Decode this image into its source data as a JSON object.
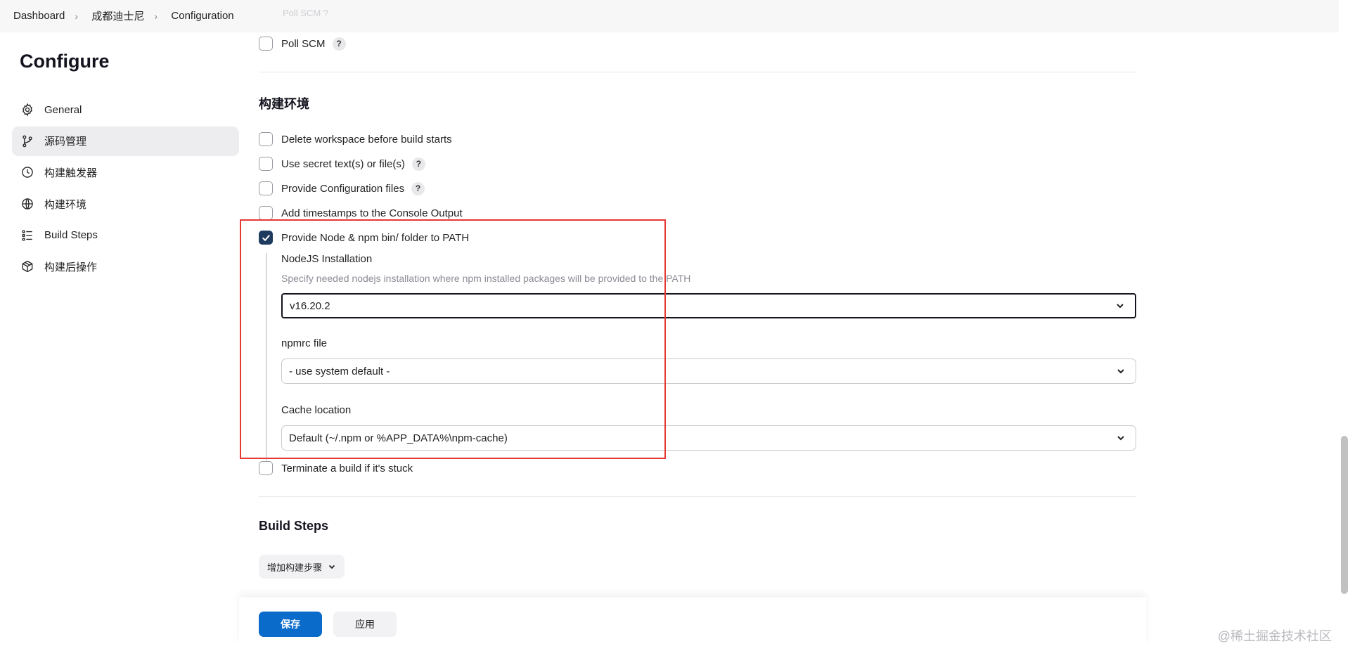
{
  "breadcrumb": {
    "items": [
      "Dashboard",
      "成都迪士尼",
      "Configuration"
    ],
    "hidden_row_text": "Poll SCM ?"
  },
  "page_title": "Configure",
  "sidebar": {
    "items": [
      {
        "label": "General",
        "icon": "gear-icon",
        "active": false
      },
      {
        "label": "源码管理",
        "icon": "source-branch-icon",
        "active": true
      },
      {
        "label": "构建触发器",
        "icon": "clock-icon",
        "active": false
      },
      {
        "label": "构建环境",
        "icon": "globe-icon",
        "active": false
      },
      {
        "label": "Build Steps",
        "icon": "list-icon",
        "active": false
      },
      {
        "label": "构建后操作",
        "icon": "package-icon",
        "active": false
      }
    ]
  },
  "triggers": {
    "poll_scm": {
      "label": "Poll SCM",
      "checked": false,
      "help": "?"
    }
  },
  "build_env": {
    "title": "构建环境",
    "options": [
      {
        "label": "Delete workspace before build starts",
        "checked": false
      },
      {
        "label": "Use secret text(s) or file(s)",
        "checked": false,
        "help": "?"
      },
      {
        "label": "Provide Configuration files",
        "checked": false,
        "help": "?"
      },
      {
        "label": "Add timestamps to the Console Output",
        "checked": false
      },
      {
        "label": "Provide Node & npm bin/ folder to PATH",
        "checked": true
      }
    ],
    "node": {
      "installation_label": "NodeJS Installation",
      "installation_desc": "Specify needed nodejs installation where npm installed packages will be provided to the PATH",
      "installation_value": "v16.20.2",
      "npmrc_label": "npmrc file",
      "npmrc_value": "- use system default -",
      "cache_label": "Cache location",
      "cache_value": "Default (~/.npm or %APP_DATA%\\npm-cache)"
    },
    "terminate": {
      "label": "Terminate a build if it's stuck",
      "checked": false
    }
  },
  "build_steps": {
    "title": "Build Steps",
    "add_label": "增加构建步骤"
  },
  "actions": {
    "save": "保存",
    "apply": "应用"
  },
  "watermark": "@稀土掘金技术社区",
  "colors": {
    "accent": "#0b6bcb",
    "checkbox_checked": "#1e3a5f",
    "highlight": "#e53935"
  }
}
